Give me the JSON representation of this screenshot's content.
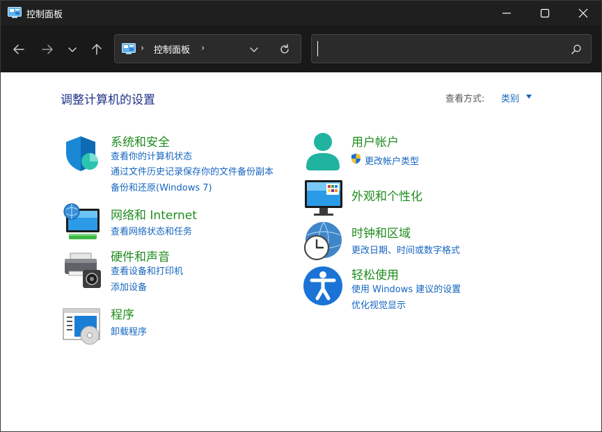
{
  "window": {
    "title": "控制面板",
    "controls": {
      "minimize": "minimize",
      "maximize": "maximize",
      "close": "close"
    }
  },
  "navbar": {
    "breadcrumb": [
      "控制面板"
    ],
    "search": {
      "value": "",
      "placeholder": ""
    }
  },
  "main": {
    "heading": "调整计算机的设置",
    "view_by": {
      "label": "查看方式:",
      "value": "类别"
    },
    "left_categories": [
      {
        "icon": "shield-icon",
        "title": "系统和安全",
        "links": [
          "查看你的计算机状态",
          "通过文件历史记录保存你的文件备份副本",
          "备份和还原(Windows 7)"
        ]
      },
      {
        "icon": "globe-network-icon",
        "title": "网络和 Internet",
        "links": [
          "查看网络状态和任务"
        ]
      },
      {
        "icon": "printer-icon",
        "title": "硬件和声音",
        "links": [
          "查看设备和打印机",
          "添加设备"
        ]
      },
      {
        "icon": "programs-icon",
        "title": "程序",
        "links": [
          "卸载程序"
        ]
      }
    ],
    "right_categories": [
      {
        "icon": "user-accounts-icon",
        "title": "用户帐户",
        "links": [
          "更改帐户类型"
        ]
      },
      {
        "icon": "appearance-icon",
        "title": "外观和个性化",
        "links": []
      },
      {
        "icon": "clock-globe-icon",
        "title": "时钟和区域",
        "links": [
          "更改日期、时间或数字格式"
        ]
      },
      {
        "icon": "accessibility-icon",
        "title": "轻松使用",
        "links": [
          "使用 Windows 建议的设置",
          "优化视觉显示"
        ]
      }
    ]
  },
  "colors": {
    "heading": "#1e3287",
    "category_title": "#1f8c1f",
    "link": "#1565c0",
    "titlebar": "#1f1f1f",
    "navbar": "#191919"
  }
}
